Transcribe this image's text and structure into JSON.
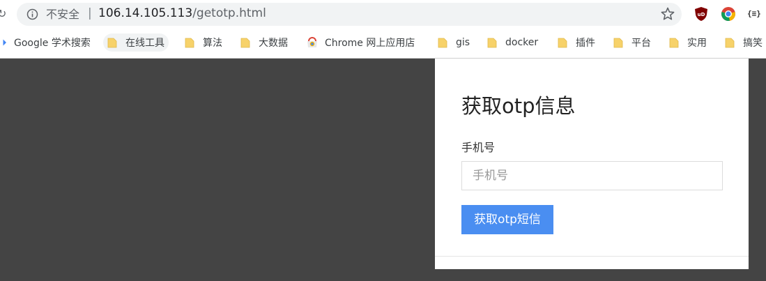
{
  "browser": {
    "security_label": "不安全",
    "separator": "|",
    "url_host": "106.14.105.113",
    "url_path": "/getotp.html",
    "extensions": [
      "ublock-icon",
      "chrome-color-icon",
      "json-viewer-icon"
    ],
    "json_ext_label": "{≡}"
  },
  "bookmarks": [
    {
      "label": "Google 学术搜索",
      "icon": "google-scholar-icon"
    },
    {
      "label": "在线工具",
      "icon": "folder-icon"
    },
    {
      "label": "算法",
      "icon": "folder-icon"
    },
    {
      "label": "大数据",
      "icon": "folder-icon"
    },
    {
      "label": "Chrome 网上应用店",
      "icon": "chrome-webstore-icon"
    },
    {
      "label": "gis",
      "icon": "folder-icon"
    },
    {
      "label": "docker",
      "icon": "folder-icon"
    },
    {
      "label": "插件",
      "icon": "folder-icon"
    },
    {
      "label": "平台",
      "icon": "folder-icon"
    },
    {
      "label": "实用",
      "icon": "folder-icon"
    },
    {
      "label": "搞笑",
      "icon": "folder-icon"
    }
  ],
  "page": {
    "title": "获取otp信息",
    "phone_label": "手机号",
    "phone_placeholder": "手机号",
    "phone_value": "",
    "submit_label": "获取otp短信"
  },
  "colors": {
    "page_background": "#444444",
    "button_primary": "#4a8ef1",
    "folder_yellow": "#f7d26a"
  }
}
